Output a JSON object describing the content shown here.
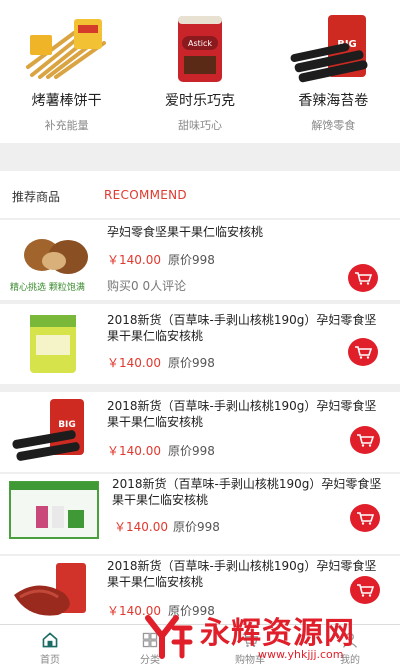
{
  "categories": [
    {
      "name": "烤薯棒饼干",
      "sub": "补充能量",
      "icon": "snack-sticks-image"
    },
    {
      "name": "爱时乐巧克",
      "sub": "甜味巧心",
      "icon": "chocolate-tin-image"
    },
    {
      "name": "香辣海苔卷",
      "sub": "解馋零食",
      "icon": "seaweed-roll-image"
    }
  ],
  "recommend": {
    "title": "推荐商品",
    "subtitle": "RECOMMEND"
  },
  "products": [
    {
      "title": "孕妇零食坚果干果仁临安核桃",
      "price": "￥140.00",
      "original": "原价998",
      "meta": "购买0  0人评论",
      "image_caption": "精心挑选 颗粒饱满",
      "icon": "walnut-image"
    },
    {
      "title": "2018新货（百草味-手剥山核桃190g）孕妇零食坚果干果仁临安核桃",
      "price": "￥140.00",
      "original": "原价998",
      "icon": "snack-bag-image"
    },
    {
      "title": "2018新货（百草味-手剥山核桃190g）孕妇零食坚果干果仁临安核桃",
      "price": "￥140.00",
      "original": "原价998",
      "icon": "seaweed-roll-image"
    },
    {
      "title": "2018新货（百草味-手剥山核桃190g）孕妇零食坚果干果仁临安核桃",
      "price": "￥140.00",
      "original": "原价998",
      "icon": "gift-box-image"
    },
    {
      "title": "2018新货（百草味-手剥山核桃190g）孕妇零食坚果干果仁临安核桃",
      "price": "￥140.00",
      "original": "原价998",
      "icon": "jerky-image"
    }
  ],
  "tabs": [
    {
      "label": "首页",
      "icon": "home-icon",
      "active": true
    },
    {
      "label": "分类",
      "icon": "category-icon"
    },
    {
      "label": "购物车",
      "icon": "cart-icon"
    },
    {
      "label": "我的",
      "icon": "user-icon"
    }
  ],
  "watermark": {
    "text": "永辉资源网",
    "url": "www.yhkjjj.com"
  },
  "colors": {
    "accent": "#e01f2a",
    "price": "#e0392f"
  }
}
